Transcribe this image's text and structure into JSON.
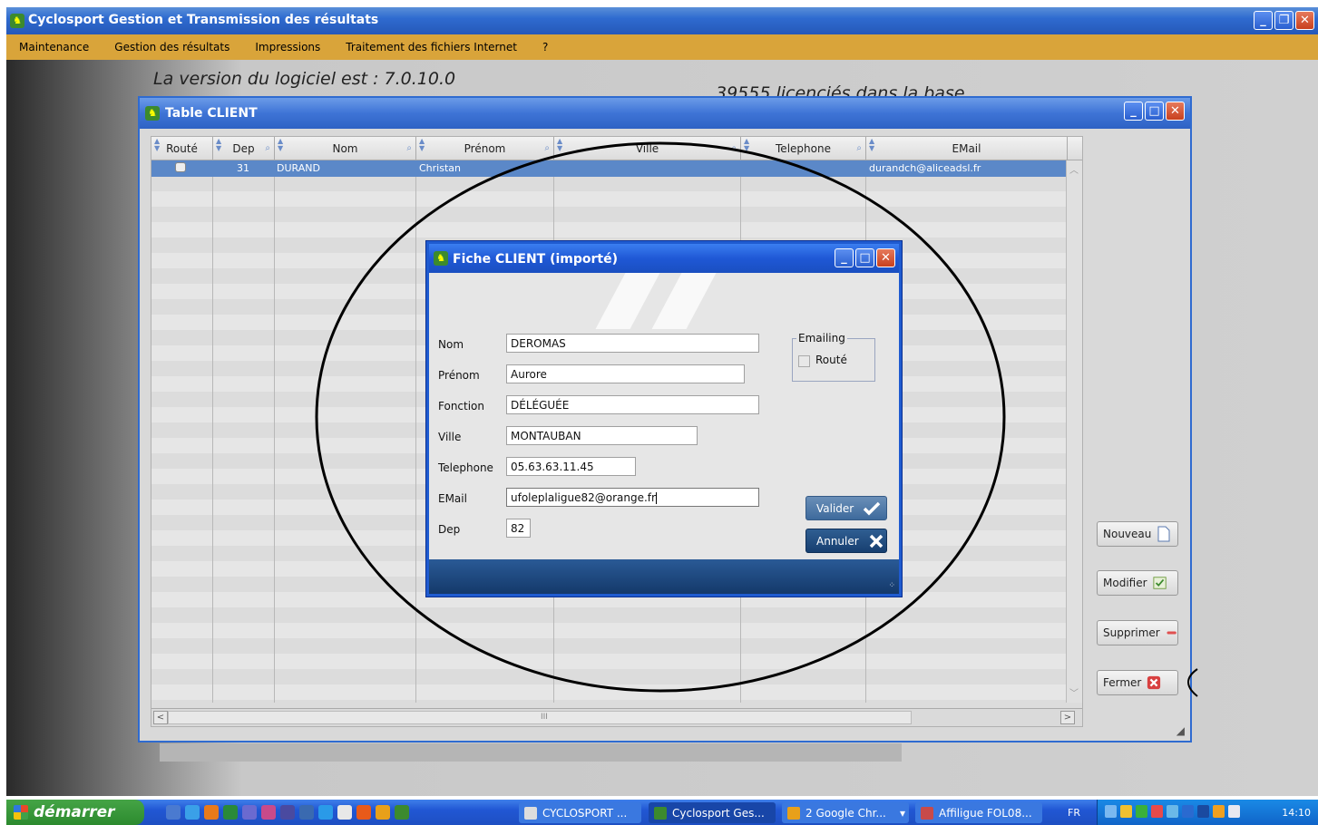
{
  "app": {
    "title": "Cyclosport Gestion et Transmission des résultats",
    "window_buttons": [
      "_",
      "❐",
      "✕"
    ]
  },
  "menu": {
    "items": [
      "Maintenance",
      "Gestion des résultats",
      "Impressions",
      "Traitement des fichiers Internet",
      "?"
    ]
  },
  "header": {
    "version_text": "La version  du logiciel est : 7.0.10.0",
    "licencies_text": "39555 licenciés dans la base"
  },
  "table_window": {
    "title": "Table CLIENT",
    "columns": [
      "Routé",
      "Dep",
      "Nom",
      "Prénom",
      "Ville",
      "Telephone",
      "EMail"
    ],
    "selected_row": {
      "dep": "31",
      "nom": "DURAND",
      "prenom": "Christan",
      "ville": "",
      "telephone": "",
      "email": "durandch@aliceadsl.fr"
    },
    "scroll_label": "III",
    "buttons": {
      "nouveau": "Nouveau",
      "modifier": "Modifier",
      "supprimer": "Supprimer",
      "fermer": "Fermer"
    }
  },
  "dialog": {
    "title": "Fiche CLIENT (importé)",
    "fields": {
      "nom_label": "Nom",
      "nom_value": "DEROMAS",
      "prenom_label": "Prénom",
      "prenom_value": "Aurore",
      "fonction_label": "Fonction",
      "fonction_value": "DÉLÉGUÉE",
      "ville_label": "Ville",
      "ville_value": "MONTAUBAN",
      "telephone_label": "Telephone",
      "telephone_value": "05.63.63.11.45",
      "email_label": "EMail",
      "email_value": "ufoleplaligue82@orange.fr",
      "dep_label": "Dep",
      "dep_value": "82"
    },
    "emailing": {
      "legend": "Emailing",
      "checkbox_label": "Routé",
      "checked": false
    },
    "valider": "Valider",
    "annuler": "Annuler"
  },
  "taskbar": {
    "start": "démarrer",
    "tasks": [
      "CYCLOSPORT ...",
      "Cyclosport Ges...",
      "2 Google Chr...",
      "Affiligue FOL08..."
    ],
    "language": "FR",
    "clock": "14:10"
  },
  "colors": {
    "titlebar_blue": "#2f6bd0",
    "menu_orange": "#d9a43a",
    "selection_blue": "#5b88c8",
    "dialog_footer": "#1e4a80",
    "taskbar_blue": "#2157d4",
    "start_green": "#3a9a3c"
  }
}
